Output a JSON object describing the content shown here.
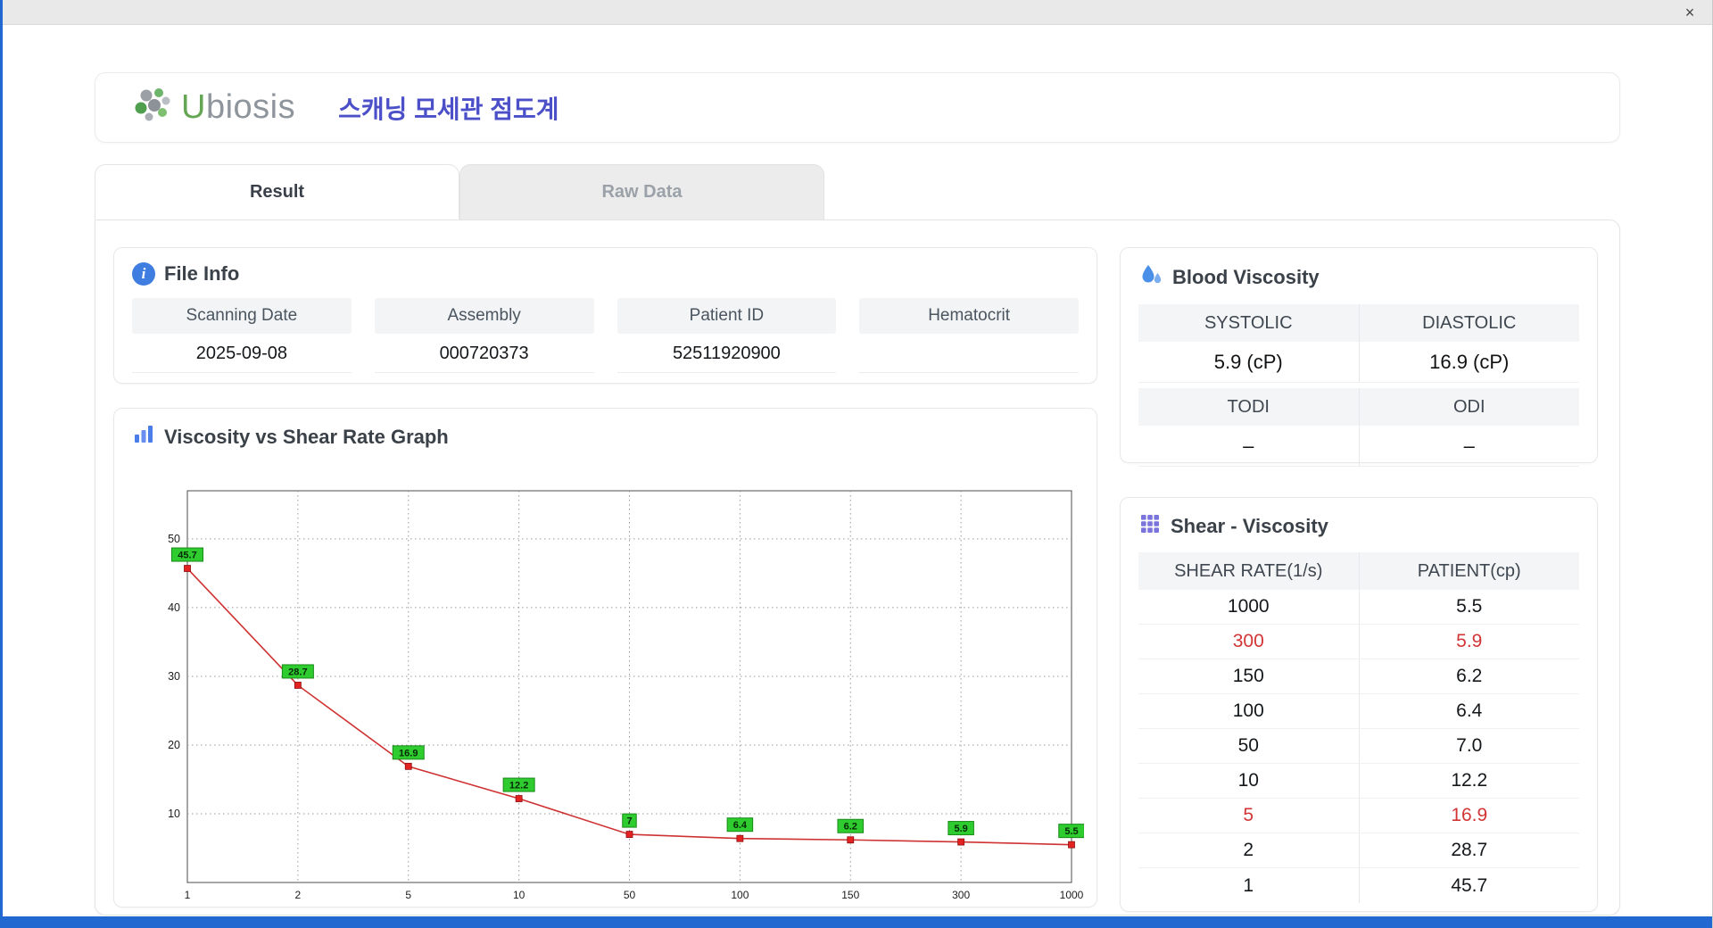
{
  "window": {
    "close_label": "×"
  },
  "header": {
    "brand_initial": "U",
    "brand_rest": "biosis",
    "title": "스캐닝 모세관 점도계"
  },
  "tabs": [
    {
      "label": "Result"
    },
    {
      "label": "Raw Data"
    }
  ],
  "file_info": {
    "title": "File Info",
    "fields": [
      {
        "label": "Scanning Date",
        "value": "2025-09-08"
      },
      {
        "label": "Assembly",
        "value": "000720373"
      },
      {
        "label": "Patient ID",
        "value": "52511920900"
      },
      {
        "label": "Hematocrit",
        "value": ""
      }
    ]
  },
  "blood_viscosity": {
    "title": "Blood Viscosity",
    "sections": [
      {
        "headers": [
          "SYSTOLIC",
          "DIASTOLIC"
        ],
        "values": [
          "5.9 (cP)",
          "16.9 (cP)"
        ]
      },
      {
        "headers": [
          "TODI",
          "ODI"
        ],
        "values": [
          "–",
          "–"
        ]
      }
    ]
  },
  "shear_viscosity": {
    "title": "Shear - Viscosity",
    "columns": [
      "SHEAR RATE(1/s)",
      "PATIENT(cp)"
    ],
    "rows": [
      {
        "rate": "1000",
        "patient": "5.5",
        "highlight": false
      },
      {
        "rate": "300",
        "patient": "5.9",
        "highlight": true
      },
      {
        "rate": "150",
        "patient": "6.2",
        "highlight": false
      },
      {
        "rate": "100",
        "patient": "6.4",
        "highlight": false
      },
      {
        "rate": "50",
        "patient": "7.0",
        "highlight": false
      },
      {
        "rate": "10",
        "patient": "12.2",
        "highlight": false
      },
      {
        "rate": "5",
        "patient": "16.9",
        "highlight": true
      },
      {
        "rate": "2",
        "patient": "28.7",
        "highlight": false
      },
      {
        "rate": "1",
        "patient": "45.7",
        "highlight": false
      }
    ]
  },
  "chart_data": {
    "type": "line",
    "title": "Viscosity vs Shear Rate Graph",
    "categories": [
      "1",
      "2",
      "5",
      "10",
      "50",
      "100",
      "150",
      "300",
      "1000"
    ],
    "values": [
      45.7,
      28.7,
      16.9,
      12.2,
      7,
      6.4,
      6.2,
      5.9,
      5.5
    ],
    "labels": [
      "45.7",
      "28.7",
      "16.9",
      "12.2",
      "7",
      "6.4",
      "6.2",
      "5.9",
      "5.5"
    ],
    "yticks": [
      10,
      20,
      30,
      40,
      50
    ],
    "ylim": [
      0,
      57
    ],
    "grid": true,
    "legend": "none",
    "line_color": "#cf3232",
    "marker_color": "#e32222",
    "marker_edge": "#8f0e0e",
    "label_bg": "#2ecc2e",
    "label_edge": "#188a18"
  }
}
